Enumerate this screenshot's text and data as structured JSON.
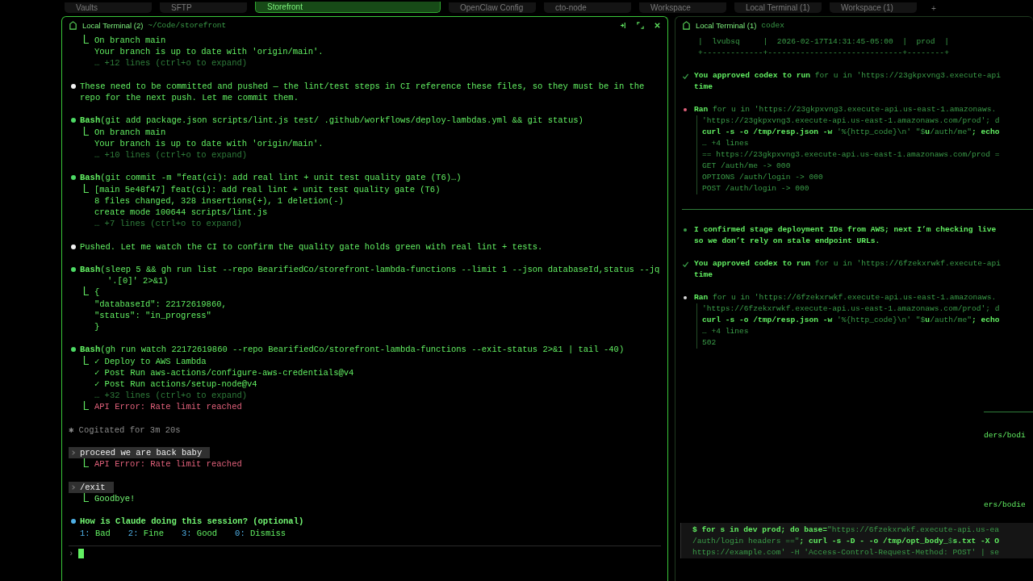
{
  "tabs": [
    {
      "label": "Vaults",
      "selected": false
    },
    {
      "label": "SFTP",
      "selected": false
    },
    {
      "label": "Storefront",
      "selected": true
    },
    {
      "label": "OpenClaw Config",
      "selected": false
    },
    {
      "label": "cto-node",
      "selected": false
    },
    {
      "label": "Workspace",
      "selected": false
    },
    {
      "label": "Local Terminal (1)",
      "selected": false
    },
    {
      "label": "Workspace (1)",
      "selected": false
    }
  ],
  "new_tab": "+",
  "left_pane": {
    "title": "Local Terminal (2)",
    "path": "~/Code/storefront",
    "blocks": [
      {
        "kind": "output",
        "output": [
          {
            "kind": "text",
            "tree": true,
            "text": "On branch main"
          },
          {
            "kind": "text",
            "tree": false,
            "text": "Your branch is up to date with 'origin/main'."
          },
          {
            "kind": "more",
            "tree": false,
            "text": "… +12 lines (ctrl+o to expand)"
          }
        ]
      },
      {
        "kind": "message",
        "text": "These need to be committed and pushed — the lint/test steps in CI reference these files, so they must be in the repo for the next push. Let me commit them."
      },
      {
        "kind": "tool",
        "tool": "Bash",
        "command": [
          "(git add package.json scripts/lint.js test/ .github/workflows/deploy-lambdas.yml && git status)"
        ],
        "output": [
          {
            "kind": "text",
            "tree": true,
            "text": "On branch main"
          },
          {
            "kind": "text",
            "tree": false,
            "text": "Your branch is up to date with 'origin/main'."
          },
          {
            "kind": "more",
            "tree": false,
            "text": "… +10 lines (ctrl+o to expand)"
          }
        ]
      },
      {
        "kind": "tool",
        "tool": "Bash",
        "command": [
          "(git commit -m \"feat(ci): add real lint + unit test quality gate (T6)…)"
        ],
        "output": [
          {
            "kind": "text",
            "tree": true,
            "text": "[main 5e48f47] feat(ci): add real lint + unit test quality gate (T6)"
          },
          {
            "kind": "text",
            "tree": false,
            "text": "8 files changed, 328 insertions(+), 1 deletion(-)"
          },
          {
            "kind": "text",
            "tree": false,
            "text": "create mode 100644 scripts/lint.js"
          },
          {
            "kind": "more",
            "tree": false,
            "text": "… +7 lines (ctrl+o to expand)"
          }
        ]
      },
      {
        "kind": "message",
        "text": "Pushed. Let me watch the CI to confirm the quality gate holds green with real lint + tests."
      },
      {
        "kind": "tool",
        "tool": "Bash",
        "command": [
          "(sleep 5 && gh run list --repo BearifiedCo/storefront-lambda-functions --limit 1 --json databaseId,status --jq",
          "'.[0]' 2>&1)"
        ],
        "output": [
          {
            "kind": "text",
            "tree": true,
            "text": "{"
          },
          {
            "kind": "text",
            "tree": false,
            "text": "\"databaseId\": 22172619860,"
          },
          {
            "kind": "text",
            "tree": false,
            "text": "\"status\": \"in_progress\""
          },
          {
            "kind": "text",
            "tree": false,
            "text": "}"
          }
        ]
      },
      {
        "kind": "tool",
        "tool": "Bash",
        "command": [
          "(gh run watch 22172619860 --repo BearifiedCo/storefront-lambda-functions --exit-status 2>&1 | tail -40)"
        ],
        "output": [
          {
            "kind": "text",
            "tree": true,
            "text": "✓ Deploy to AWS Lambda"
          },
          {
            "kind": "text",
            "tree": false,
            "text": "✓ Post Run aws-actions/configure-aws-credentials@v4"
          },
          {
            "kind": "text",
            "tree": false,
            "text": "✓ Post Run actions/setup-node@v4"
          },
          {
            "kind": "more",
            "tree": false,
            "text": "… +32 lines (ctrl+o to expand)"
          },
          {
            "kind": "error",
            "tree": true,
            "text": "API Error: Rate limit reached"
          }
        ]
      },
      {
        "kind": "status",
        "text": "✱ Cogitated for 3m 20s"
      },
      {
        "kind": "user",
        "text": "proceed we are back baby",
        "output": [
          {
            "kind": "error",
            "tree": true,
            "text": "API Error: Rate limit reached"
          }
        ]
      },
      {
        "kind": "user",
        "text": "/exit",
        "output": [
          {
            "kind": "success",
            "tree": true,
            "text": "Goodbye!"
          }
        ]
      },
      {
        "kind": "question",
        "text": "How is Claude doing this session? (optional)",
        "options": [
          {
            "key": "1:",
            "label": "Bad"
          },
          {
            "key": "2:",
            "label": "Fine"
          },
          {
            "key": "3:",
            "label": "Good"
          },
          {
            "key": "0:",
            "label": "Dismiss"
          }
        ]
      }
    ],
    "prompt": "›"
  },
  "right_pane": {
    "title": "Local Terminal (1)",
    "subtitle": "codex",
    "entries": [
      {
        "kind": "table",
        "lines": [
          "|  lvubsq     |  2026-02-17T14:31:45-05:00  |  prod  |",
          "+-------------+-----------------------------+--------+"
        ]
      },
      {
        "kind": "approval",
        "lead": "You approved codex to run",
        "detail": "for u in 'https://23gkpxvng3.execute-api",
        "tail": "time"
      },
      {
        "kind": "ran",
        "label": "Ran",
        "color": "#e0607a",
        "command": [
          "for u in 'https://23gkpxvng3.execute-api.us-east-1.amazonaws.",
          "'https://23gkpxvng3.execute-api.us-east-1.amazonaws.com/prod'; d",
          "**curl -s -o /tmp/resp.json -w** '%{http_code}\\n' \"$**u**/auth/me\"**; echo**",
          "… +4 lines"
        ],
        "output": [
          "== https://23gkpxvng3.execute-api.us-east-1.amazonaws.com/prod =",
          "GET /auth/me -> 000",
          "OPTIONS /auth/login -> 000",
          "POST /auth/login -> 000"
        ]
      },
      {
        "kind": "rule"
      },
      {
        "kind": "message",
        "lines": [
          "I confirmed stage deployment IDs from AWS; next I’m checking live",
          "so we don’t rely on stale endpoint URLs."
        ]
      },
      {
        "kind": "approval",
        "lead": "You approved codex to run",
        "detail": "for u in 'https://6fzekxrwkf.execute-api",
        "tail": "time"
      },
      {
        "kind": "ran",
        "label": "Ran",
        "color": "#d8d8d8",
        "command": [
          "for u in 'https://6fzekxrwkf.execute-api.us-east-1.amazonaws.",
          "'https://6fzekxrwkf.execute-api.us-east-1.amazonaws.com/prod'; d",
          "**curl -s -o /tmp/resp.json -w** '%{http_code}\\n' \"$**u**/auth/me\"**; echo**",
          "… +4 lines"
        ],
        "output": [
          "502"
        ]
      },
      {
        "kind": "obscured",
        "fragments": [
          "ders/bodi",
          "ers/bodie"
        ]
      },
      {
        "kind": "shell",
        "lines": [
          "**$ for s in dev prod; do base=**\"https://6fzekxrwkf.execute-api.us-ea",
          "/auth/login headers ==\"**; curl -s -D - -o /tmp/opt_body_**$**s.txt -X O**",
          "https://example.com' -H 'Access-Control-Request-Method: POST' | se"
        ]
      }
    ]
  }
}
